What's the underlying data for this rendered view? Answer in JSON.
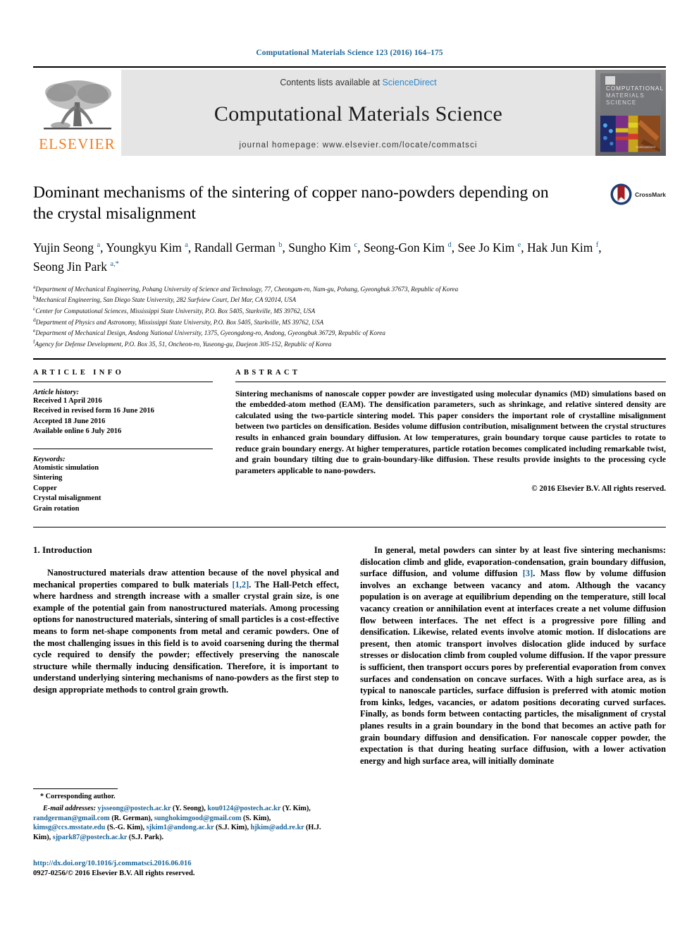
{
  "runhead": "Computational Materials Science 123 (2016) 164–175",
  "masthead": {
    "contents_prefix": "Contents lists available at ",
    "sciencedirect": "ScienceDirect",
    "journal_title": "Computational Materials Science",
    "homepage": "journal homepage: www.elsevier.com/locate/commatsci",
    "publisher_logo_text": "ELSEVIER",
    "cover_title_line1": "COMPUTATIONAL",
    "cover_title_line2": "MATERIALS",
    "cover_title_line3": "SCIENCE",
    "cover_footer": "ScienceDirect"
  },
  "article": {
    "title": "Dominant mechanisms of the sintering of copper nano-powders depending on the crystal misalignment",
    "crossmark_label": "CrossMark",
    "authors_html": "Yujin Seong <sup>a</sup>, Youngkyu Kim <sup>a</sup>, Randall German <sup>b</sup>, Sungho Kim <sup>c</sup>, Seong-Gon Kim <sup>d</sup>, See Jo Kim <sup>e</sup>, Hak Jun Kim <sup>f</sup>, Seong Jin Park <sup>a,*</sup>",
    "affiliations": [
      {
        "mark": "a",
        "text": "Department of Mechanical Engineering, Pohang University of Science and Technology, 77, Cheongam-ro, Nam-gu, Pohang, Gyeongbuk 37673, Republic of Korea"
      },
      {
        "mark": "b",
        "text": "Mechanical Engineering, San Diego State University, 282 Surfview Court, Del Mar, CA 92014, USA"
      },
      {
        "mark": "c",
        "text": "Center for Computational Sciences, Mississippi State University, P.O. Box 5405, Starkville, MS 39762, USA"
      },
      {
        "mark": "d",
        "text": "Department of Physics and Astronomy, Mississippi State University, P.O. Box 5405, Starkville, MS 39762, USA"
      },
      {
        "mark": "e",
        "text": "Department of Mechanical Design, Andong National University, 1375, Gyeongdong-ro, Andong, Gyeongbuk 36729, Republic of Korea"
      },
      {
        "mark": "f",
        "text": "Agency for Defense Development, P.O. Box 35, 51, Oncheon-ro, Yuseong-gu, Daejeon 305-152, Republic of Korea"
      }
    ]
  },
  "article_info": {
    "heading": "ARTICLE INFO",
    "history_label": "Article history:",
    "history": [
      "Received 1 April 2016",
      "Received in revised form 16 June 2016",
      "Accepted 18 June 2016",
      "Available online 6 July 2016"
    ],
    "keywords_label": "Keywords:",
    "keywords": [
      "Atomistic simulation",
      "Sintering",
      "Copper",
      "Crystal misalignment",
      "Grain rotation"
    ]
  },
  "abstract": {
    "heading": "ABSTRACT",
    "text": "Sintering mechanisms of nanoscale copper powder are investigated using molecular dynamics (MD) simulations based on the embedded-atom method (EAM). The densification parameters, such as shrinkage, and relative sintered density are calculated using the two-particle sintering model. This paper considers the important role of crystalline misalignment between two particles on densification. Besides volume diffusion contribution, misalignment between the crystal structures results in enhanced grain boundary diffusion. At low temperatures, grain boundary torque cause particles to rotate to reduce grain boundary energy. At higher temperatures, particle rotation becomes complicated including remarkable twist, and grain boundary tilting due to grain-boundary-like diffusion. These results provide insights to the processing cycle parameters applicable to nano-powders.",
    "copyright": "© 2016 Elsevier B.V. All rights reserved."
  },
  "body": {
    "section_heading": "1. Introduction",
    "left_paragraph_html": "Nanostructured materials draw attention because of the novel physical and mechanical properties compared to bulk materials <span class=\"ref\">[1,2]</span>. The Hall-Petch effect, where hardness and strength increase with a smaller crystal grain size, is one example of the potential gain from nanostructured materials. Among processing options for nanostructured materials, sintering of small particles is a cost-effective means to form net-shape components from metal and ceramic powders. One of the most challenging issues in this field is to avoid coarsening during the thermal cycle required to densify the powder; effectively preserving the nanoscale structure while thermally inducing densification. Therefore, it is important to understand underlying sintering mechanisms of nano-powders as the first step to design appropriate methods to control grain growth.",
    "right_paragraph_html": "In general, metal powders can sinter by at least five sintering mechanisms: dislocation climb and glide, evaporation-condensation, grain boundary diffusion, surface diffusion, and volume diffusion <span class=\"ref\">[3]</span>. Mass flow by volume diffusion involves an exchange between vacancy and atom. Although the vacancy population is on average at equilibrium depending on the temperature, still local vacancy creation or annihilation event at interfaces create a net volume diffusion flow between interfaces. The net effect is a progressive pore filling and densification. Likewise, related events involve atomic motion. If dislocations are present, then atomic transport involves dislocation glide induced by surface stresses or dislocation climb from coupled volume diffusion. If the vapor pressure is sufficient, then transport occurs pores by preferential evaporation from convex surfaces and condensation on concave surfaces. With a high surface area, as is typical to nanoscale particles, surface diffusion is preferred with atomic motion from kinks, ledges, vacancies, or adatom positions decorating curved surfaces. Finally, as bonds form between contacting particles, the misalignment of crystal planes results in a grain boundary in the bond that becomes an active path for grain boundary diffusion and densification. For nanoscale copper powder, the expectation is that during heating surface diffusion, with a lower activation energy and high surface area, will initially dominate"
  },
  "footnote": {
    "corresponding": "* Corresponding author.",
    "email_label": "E-mail addresses:",
    "emails_html": "<span class=\"mail\">yjsseong@postech.ac.kr</span> (Y. Seong), <span class=\"mail\">kou0124@postech.ac.kr</span> (Y. Kim), <span class=\"mail\">randgerman@gmail.com</span> (R. German), <span class=\"mail\">sunghokimgood@gmail.com</span> (S. Kim), <span class=\"mail\">kimsg@ccs.msstate.edu</span> (S.-G. Kim), <span class=\"mail\">sjkim1@andong.ac.kr</span> (S.J. Kim), <span class=\"mail\">hjkim@add.re.kr</span> (H.J. Kim), <span class=\"mail\">sjpark87@postech.ac.kr</span> (S.J. Park)."
  },
  "publication": {
    "doi": "http://dx.doi.org/10.1016/j.commatsci.2016.06.016",
    "issn_line": "0927-0256/© 2016 Elsevier B.V. All rights reserved."
  },
  "colors": {
    "link": "#1a6496",
    "elsevier_orange": "#ef7d22",
    "sciencedirect_blue": "#2e86c8",
    "band_gray": "#e5e5e5"
  }
}
